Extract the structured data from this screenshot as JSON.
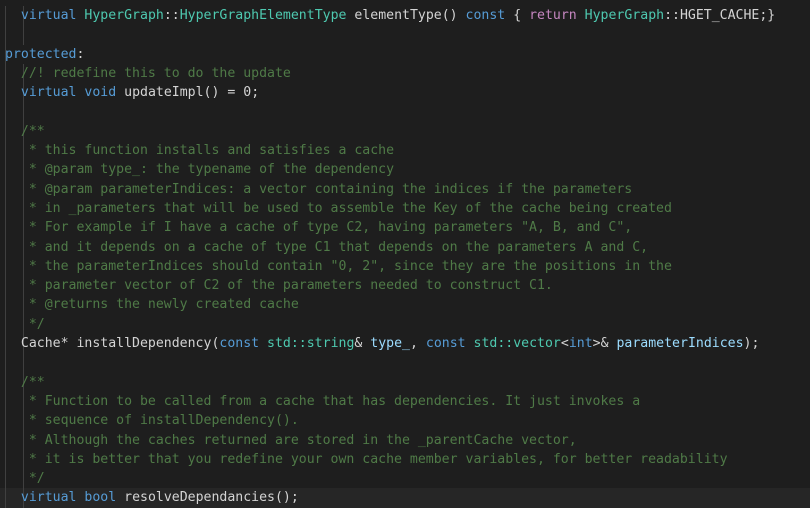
{
  "editor": {
    "language": "C++",
    "theme": "dark-plus",
    "background_color": "#1e1e1e",
    "current_line_highlight_color": "#262626",
    "colors": {
      "keyword": "#569cd6",
      "control_keyword": "#c586c0",
      "type": "#4ec9b0",
      "comment": "#4f7a47",
      "parameter": "#9cdcfe",
      "plain_text": "#d4d4d4"
    }
  },
  "lines": [
    {
      "n": 1,
      "indent": 1,
      "current": false,
      "tokens": [
        {
          "t": "virtual",
          "c": "kw"
        },
        {
          "t": " ",
          "c": "plain"
        },
        {
          "t": "HyperGraph",
          "c": "type"
        },
        {
          "t": "::",
          "c": "plain"
        },
        {
          "t": "HyperGraphElementType",
          "c": "type"
        },
        {
          "t": " elementType() ",
          "c": "plain"
        },
        {
          "t": "const",
          "c": "kw"
        },
        {
          "t": " { ",
          "c": "plain"
        },
        {
          "t": "return",
          "c": "ctrl"
        },
        {
          "t": " ",
          "c": "plain"
        },
        {
          "t": "HyperGraph",
          "c": "type"
        },
        {
          "t": "::HGET_CACHE;}",
          "c": "plain"
        }
      ]
    },
    {
      "n": 2,
      "indent": 1,
      "current": false,
      "tokens": []
    },
    {
      "n": 3,
      "indent": 0,
      "current": false,
      "tokens": [
        {
          "t": "protected",
          "c": "kw"
        },
        {
          "t": ":",
          "c": "plain"
        }
      ]
    },
    {
      "n": 4,
      "indent": 1,
      "current": false,
      "tokens": [
        {
          "t": "//! redefine this to do the update",
          "c": "comment"
        }
      ]
    },
    {
      "n": 5,
      "indent": 1,
      "current": false,
      "tokens": [
        {
          "t": "virtual",
          "c": "kw"
        },
        {
          "t": " ",
          "c": "plain"
        },
        {
          "t": "void",
          "c": "kw"
        },
        {
          "t": " updateImpl() = ",
          "c": "plain"
        },
        {
          "t": "0",
          "c": "plain"
        },
        {
          "t": ";",
          "c": "plain"
        }
      ]
    },
    {
      "n": 6,
      "indent": 1,
      "current": false,
      "tokens": []
    },
    {
      "n": 7,
      "indent": 1,
      "current": false,
      "tokens": [
        {
          "t": "/**",
          "c": "comment"
        }
      ]
    },
    {
      "n": 8,
      "indent": 1,
      "current": false,
      "tokens": [
        {
          "t": " * this function installs and satisfies a cache",
          "c": "comment"
        }
      ]
    },
    {
      "n": 9,
      "indent": 1,
      "current": false,
      "tokens": [
        {
          "t": " * @param type_: the typename of the dependency",
          "c": "comment"
        }
      ]
    },
    {
      "n": 10,
      "indent": 1,
      "current": false,
      "tokens": [
        {
          "t": " * @param parameterIndices: a vector containing the indices if the parameters",
          "c": "comment"
        }
      ]
    },
    {
      "n": 11,
      "indent": 1,
      "current": false,
      "tokens": [
        {
          "t": " * in _parameters that will be used to assemble the Key of the cache being created",
          "c": "comment"
        }
      ]
    },
    {
      "n": 12,
      "indent": 1,
      "current": false,
      "tokens": [
        {
          "t": " * For example if I have a cache of type C2, having parameters \"A, B, and C\",",
          "c": "comment"
        }
      ]
    },
    {
      "n": 13,
      "indent": 1,
      "current": false,
      "tokens": [
        {
          "t": " * and it depends on a cache of type C1 that depends on the parameters A and C,",
          "c": "comment"
        }
      ]
    },
    {
      "n": 14,
      "indent": 1,
      "current": false,
      "tokens": [
        {
          "t": " * the parameterIndices should contain \"0, 2\", since they are the positions in the",
          "c": "comment"
        }
      ]
    },
    {
      "n": 15,
      "indent": 1,
      "current": false,
      "tokens": [
        {
          "t": " * parameter vector of C2 of the parameters needed to construct C1.",
          "c": "comment"
        }
      ]
    },
    {
      "n": 16,
      "indent": 1,
      "current": false,
      "tokens": [
        {
          "t": " * @returns the newly created cache",
          "c": "comment"
        }
      ]
    },
    {
      "n": 17,
      "indent": 1,
      "current": false,
      "tokens": [
        {
          "t": " */",
          "c": "comment"
        }
      ]
    },
    {
      "n": 18,
      "indent": 1,
      "current": false,
      "tokens": [
        {
          "t": "Cache* installDependency(",
          "c": "plain"
        },
        {
          "t": "const",
          "c": "kw"
        },
        {
          "t": " ",
          "c": "plain"
        },
        {
          "t": "std::string",
          "c": "type"
        },
        {
          "t": "& ",
          "c": "plain"
        },
        {
          "t": "type_",
          "c": "param"
        },
        {
          "t": ", ",
          "c": "plain"
        },
        {
          "t": "const",
          "c": "kw"
        },
        {
          "t": " ",
          "c": "plain"
        },
        {
          "t": "std::vector",
          "c": "type"
        },
        {
          "t": "<",
          "c": "plain"
        },
        {
          "t": "int",
          "c": "kw"
        },
        {
          "t": ">& ",
          "c": "plain"
        },
        {
          "t": "parameterIndices",
          "c": "param"
        },
        {
          "t": ");",
          "c": "plain"
        }
      ]
    },
    {
      "n": 19,
      "indent": 1,
      "current": false,
      "tokens": []
    },
    {
      "n": 20,
      "indent": 1,
      "current": false,
      "tokens": [
        {
          "t": "/**",
          "c": "comment"
        }
      ]
    },
    {
      "n": 21,
      "indent": 1,
      "current": false,
      "tokens": [
        {
          "t": " * Function to be called from a cache that has dependencies. It just invokes a",
          "c": "comment"
        }
      ]
    },
    {
      "n": 22,
      "indent": 1,
      "current": false,
      "tokens": [
        {
          "t": " * sequence of installDependency().",
          "c": "comment"
        }
      ]
    },
    {
      "n": 23,
      "indent": 1,
      "current": false,
      "tokens": [
        {
          "t": " * Although the caches returned are stored in the _parentCache vector,",
          "c": "comment"
        }
      ]
    },
    {
      "n": 24,
      "indent": 1,
      "current": false,
      "tokens": [
        {
          "t": " * it is better that you redefine your own cache member variables, for better readability",
          "c": "comment"
        }
      ]
    },
    {
      "n": 25,
      "indent": 1,
      "current": false,
      "tokens": [
        {
          "t": " */",
          "c": "comment"
        }
      ]
    },
    {
      "n": 26,
      "indent": 1,
      "current": true,
      "tokens": [
        {
          "t": "virtual",
          "c": "kw"
        },
        {
          "t": " ",
          "c": "plain"
        },
        {
          "t": "bool",
          "c": "kw"
        },
        {
          "t": " resolveDependancies();",
          "c": "plain"
        }
      ]
    }
  ]
}
